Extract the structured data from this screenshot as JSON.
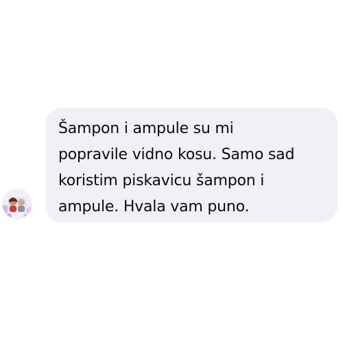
{
  "conversation": {
    "message": {
      "lines": [
        "Šampon i ampule su mi",
        "popravile vidno kosu. Samo sad",
        "koristim piskavicu šampon i",
        "ampule. Hvala vam puno."
      ]
    }
  },
  "colors": {
    "bubble_background": "#f0f0f5",
    "text": "#0b0b0b",
    "page_background": "#ffffff"
  }
}
